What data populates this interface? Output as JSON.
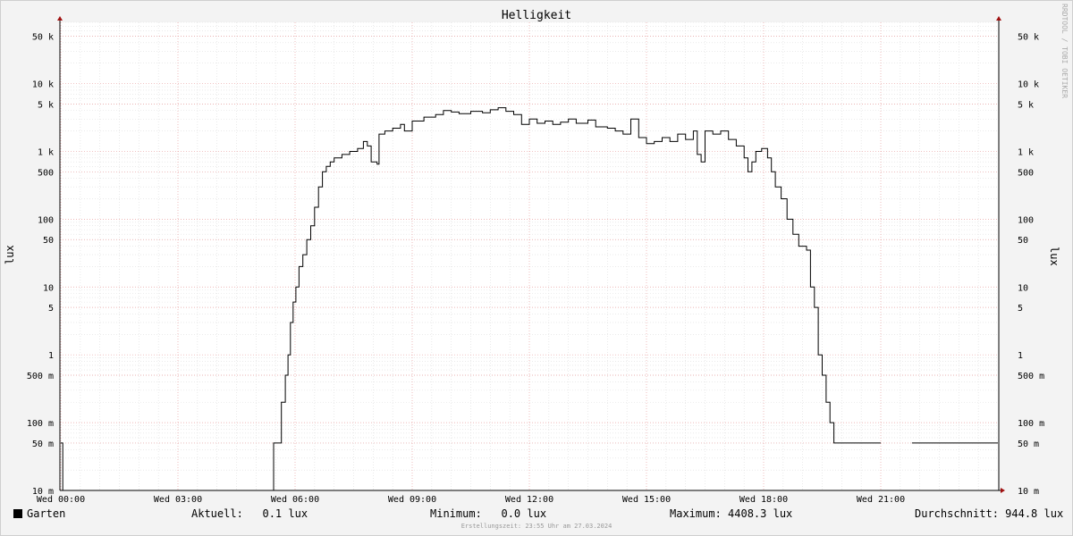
{
  "chart_data": {
    "type": "line",
    "title": "Helligkeit",
    "ylabel": "lux",
    "yscale": "log",
    "ylim": [
      0.01,
      80000
    ],
    "xlim_hours": [
      0,
      24
    ],
    "x_ticks": [
      {
        "hour": 0,
        "label": "Wed 00:00"
      },
      {
        "hour": 3,
        "label": "Wed 03:00"
      },
      {
        "hour": 6,
        "label": "Wed 06:00"
      },
      {
        "hour": 9,
        "label": "Wed 09:00"
      },
      {
        "hour": 12,
        "label": "Wed 12:00"
      },
      {
        "hour": 15,
        "label": "Wed 15:00"
      },
      {
        "hour": 18,
        "label": "Wed 18:00"
      },
      {
        "hour": 21,
        "label": "Wed 21:00"
      }
    ],
    "y_ticks": [
      {
        "value": 50000,
        "label": "50 k"
      },
      {
        "value": 10000,
        "label": "10 k"
      },
      {
        "value": 5000,
        "label": "5 k"
      },
      {
        "value": 1000,
        "label": "1 k"
      },
      {
        "value": 500,
        "label": "500"
      },
      {
        "value": 100,
        "label": "100"
      },
      {
        "value": 50,
        "label": "50"
      },
      {
        "value": 10,
        "label": "10"
      },
      {
        "value": 5,
        "label": "5"
      },
      {
        "value": 1,
        "label": "1"
      },
      {
        "value": 0.5,
        "label": "500 m"
      },
      {
        "value": 0.1,
        "label": "100 m"
      },
      {
        "value": 0.05,
        "label": "50 m"
      },
      {
        "value": 0.01,
        "label": "10 m"
      }
    ],
    "series": [
      {
        "name": "Garten",
        "color": "#000000",
        "segments": [
          [
            [
              0.0,
              0.05
            ],
            [
              0.05,
              0.05
            ],
            [
              0.05,
              0.01
            ],
            [
              5.45,
              0.01
            ],
            [
              5.45,
              0.05
            ],
            [
              5.6,
              0.05
            ],
            [
              5.65,
              0.2
            ],
            [
              5.75,
              0.5
            ],
            [
              5.82,
              1
            ],
            [
              5.88,
              3
            ],
            [
              5.95,
              6
            ],
            [
              6.02,
              10
            ],
            [
              6.1,
              20
            ],
            [
              6.2,
              30
            ],
            [
              6.3,
              50
            ],
            [
              6.4,
              80
            ],
            [
              6.5,
              150
            ],
            [
              6.6,
              300
            ],
            [
              6.7,
              500
            ],
            [
              6.8,
              600
            ],
            [
              6.9,
              700
            ],
            [
              7.0,
              800
            ],
            [
              7.2,
              900
            ],
            [
              7.4,
              1000
            ],
            [
              7.6,
              1100
            ],
            [
              7.75,
              1400
            ],
            [
              7.85,
              1200
            ],
            [
              7.95,
              700
            ],
            [
              8.1,
              650
            ],
            [
              8.15,
              1800
            ],
            [
              8.3,
              2000
            ],
            [
              8.5,
              2200
            ],
            [
              8.7,
              2500
            ],
            [
              8.8,
              2000
            ],
            [
              9.0,
              2800
            ],
            [
              9.3,
              3200
            ],
            [
              9.6,
              3500
            ],
            [
              9.8,
              4000
            ],
            [
              10.0,
              3800
            ],
            [
              10.2,
              3600
            ],
            [
              10.5,
              3900
            ],
            [
              10.8,
              3700
            ],
            [
              11.0,
              4100
            ],
            [
              11.2,
              4400
            ],
            [
              11.4,
              3900
            ],
            [
              11.6,
              3500
            ],
            [
              11.8,
              2500
            ],
            [
              12.0,
              3000
            ],
            [
              12.2,
              2600
            ],
            [
              12.4,
              2800
            ],
            [
              12.6,
              2500
            ],
            [
              12.8,
              2700
            ],
            [
              13.0,
              3000
            ],
            [
              13.2,
              2600
            ],
            [
              13.5,
              2900
            ],
            [
              13.7,
              2300
            ],
            [
              14.0,
              2200
            ],
            [
              14.2,
              2000
            ],
            [
              14.4,
              1800
            ],
            [
              14.6,
              3000
            ],
            [
              14.8,
              1600
            ],
            [
              15.0,
              1300
            ],
            [
              15.2,
              1400
            ],
            [
              15.4,
              1600
            ],
            [
              15.6,
              1400
            ],
            [
              15.8,
              1800
            ],
            [
              16.0,
              1500
            ],
            [
              16.2,
              2000
            ],
            [
              16.3,
              900
            ],
            [
              16.4,
              700
            ],
            [
              16.5,
              2000
            ],
            [
              16.7,
              1800
            ],
            [
              16.9,
              2000
            ],
            [
              17.1,
              1500
            ],
            [
              17.3,
              1200
            ],
            [
              17.5,
              800
            ],
            [
              17.6,
              500
            ],
            [
              17.7,
              700
            ],
            [
              17.8,
              1000
            ],
            [
              17.95,
              1100
            ],
            [
              18.1,
              800
            ],
            [
              18.2,
              500
            ],
            [
              18.3,
              300
            ],
            [
              18.45,
              200
            ],
            [
              18.6,
              100
            ],
            [
              18.75,
              60
            ],
            [
              18.9,
              40
            ],
            [
              19.1,
              35
            ],
            [
              19.2,
              10
            ],
            [
              19.3,
              5
            ],
            [
              19.4,
              1
            ],
            [
              19.5,
              0.5
            ],
            [
              19.6,
              0.2
            ],
            [
              19.7,
              0.1
            ],
            [
              19.8,
              0.05
            ],
            [
              20.0,
              0.05
            ],
            [
              20.5,
              0.05
            ],
            [
              21.0,
              0.05
            ]
          ],
          [
            [
              21.8,
              0.05
            ],
            [
              24.0,
              0.05
            ]
          ]
        ]
      }
    ]
  },
  "legend": {
    "series_label": "Garten",
    "aktuell": "Aktuell:   0.1 lux",
    "minimum": "Minimum:   0.0 lux",
    "maximum": "Maximum: 4408.3 lux",
    "durchschnitt": "Durchschnitt: 944.8 lux"
  },
  "watermark": "RRDTOOL / TOBI OETIKER",
  "footer": "Erstellungszeit: 23:55 Uhr am 27.03.2024",
  "colors": {
    "background": "#f3f3f3",
    "canvas": "#ffffff",
    "minor_grid": "#dddddd",
    "major_grid": "#e8a0a0",
    "arrow": "#a01010",
    "line": "#000000"
  }
}
